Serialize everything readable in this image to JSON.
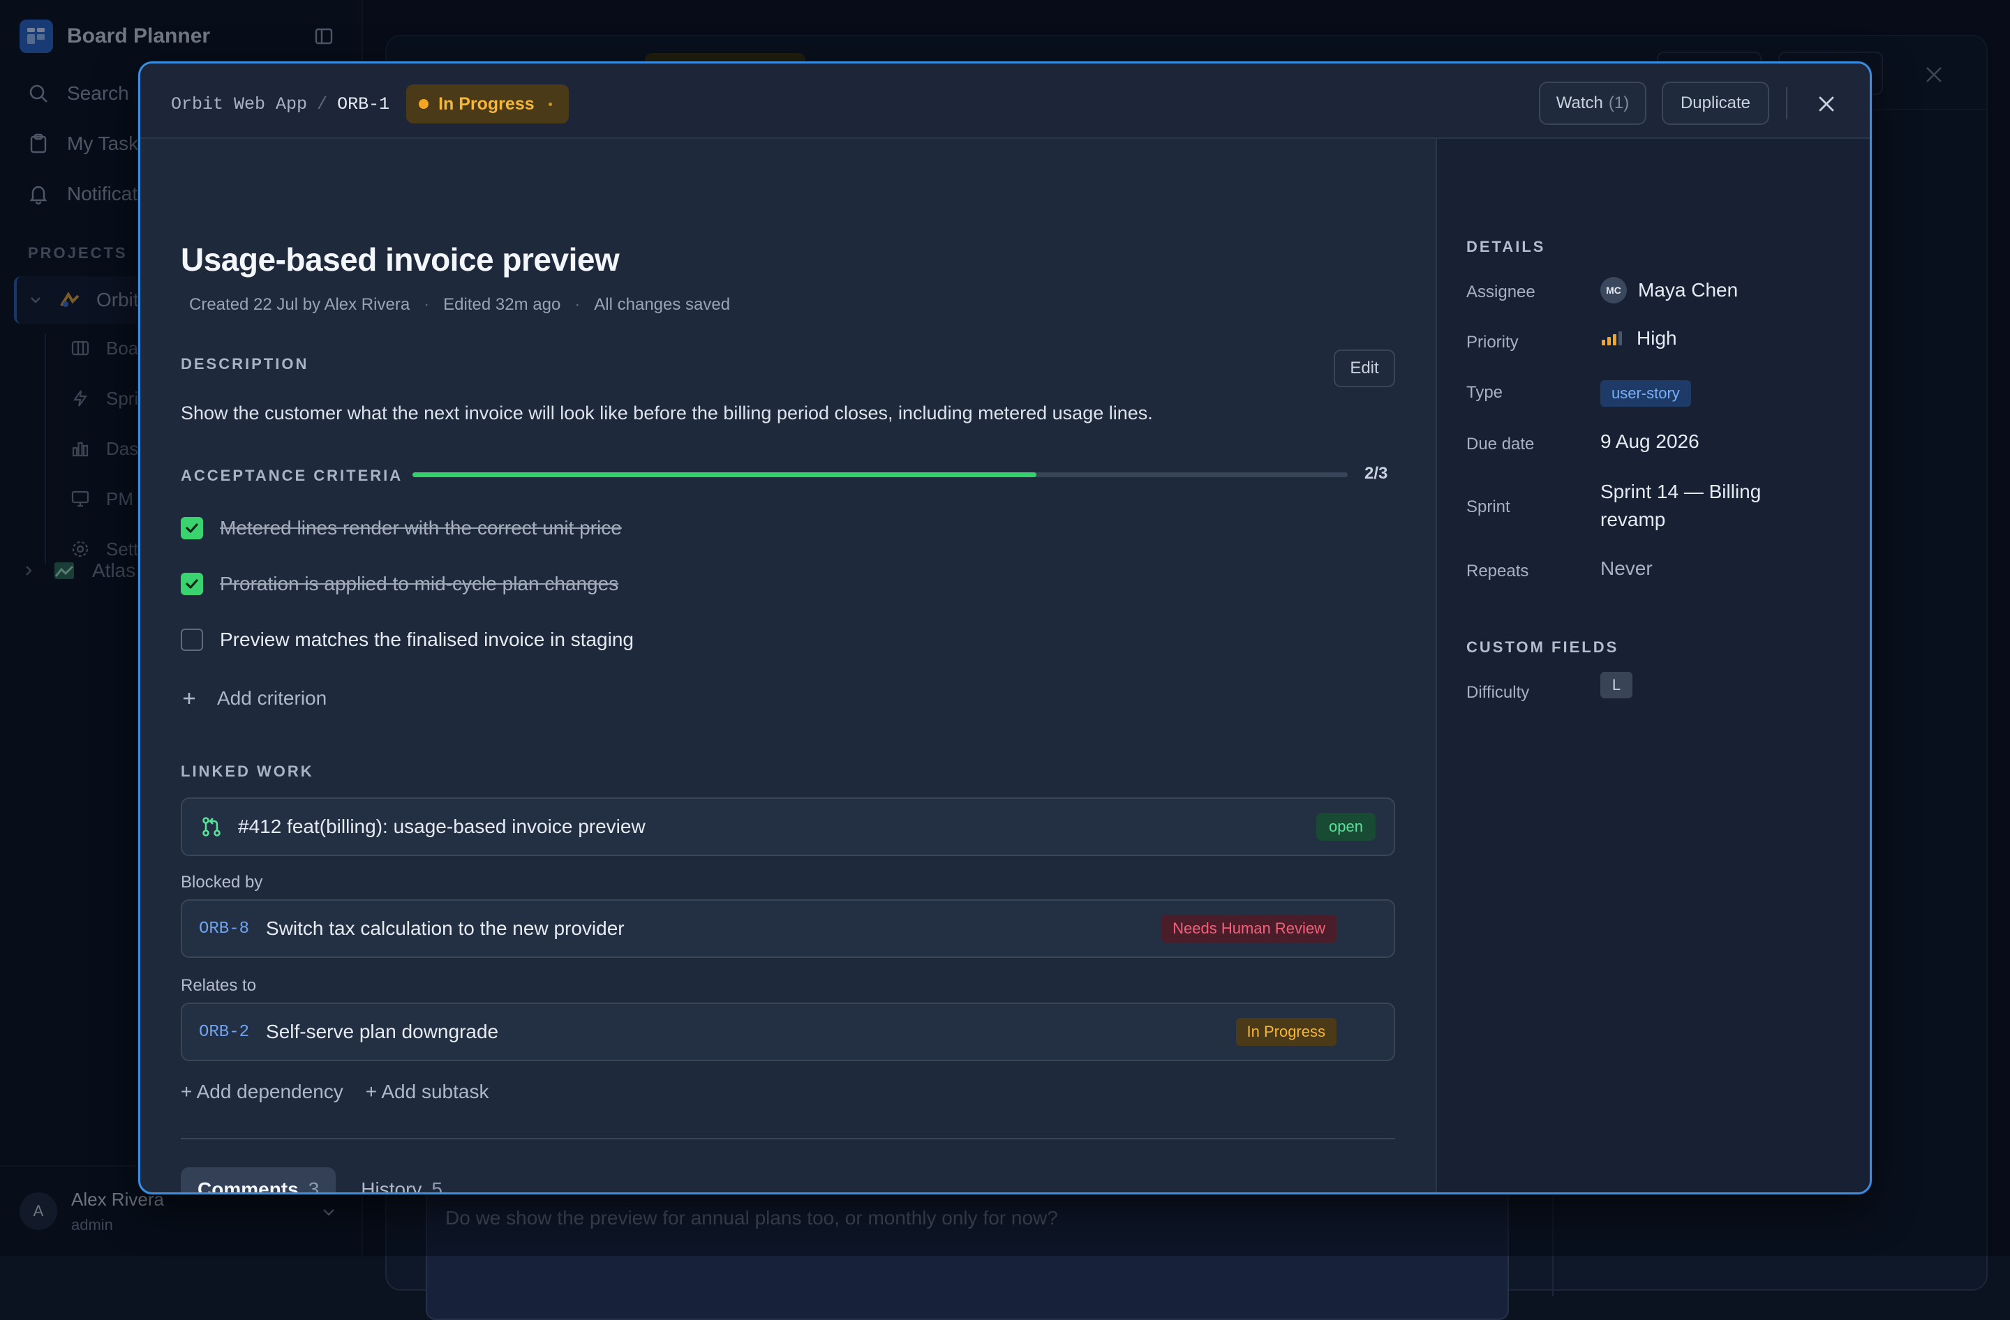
{
  "app": {
    "brand": "Board Planner",
    "nav": [
      {
        "label": "Search",
        "icon": "search-icon"
      },
      {
        "label": "My Tasks",
        "icon": "clipboard-icon"
      },
      {
        "label": "Notifications",
        "icon": "bell-icon"
      }
    ],
    "projects_label": "PROJECTS",
    "project_active": "Orbit Web App",
    "project_sub": [
      {
        "label": "Board",
        "icon": "board-icon"
      },
      {
        "label": "Sprints",
        "icon": "bolt-icon"
      },
      {
        "label": "Dashboard",
        "icon": "chart-icon"
      },
      {
        "label": "PM Agent",
        "icon": "monitor-icon"
      },
      {
        "label": "Settings",
        "icon": "gear-icon"
      }
    ],
    "project_other": "Atlas",
    "user": {
      "initial": "A",
      "name": "Alex Rivera",
      "role": "admin"
    },
    "bg_comment_placeholder": "Do we show the preview for annual plans too, or monthly only for now?"
  },
  "modal": {
    "breadcrumb": {
      "project": "Orbit Web App",
      "separator": "/",
      "id": "ORB-1"
    },
    "status": {
      "label": "In Progress",
      "color": "#f5a524"
    },
    "header_buttons": {
      "watch": "Watch",
      "watch_count": "(1)",
      "duplicate": "Duplicate"
    },
    "title": "Usage-based invoice preview",
    "meta": {
      "created": "Created 22 Jul by Alex Rivera",
      "edited": "Edited 32m ago",
      "saved": "All changes saved",
      "sep": "·"
    },
    "description": {
      "label": "DESCRIPTION",
      "edit": "Edit",
      "text": "Show the customer what the next invoice will look like before the billing period closes, including metered usage lines."
    },
    "criteria": {
      "label": "ACCEPTANCE CRITERIA",
      "progress_text": "2/3",
      "progress_fraction": 0.667,
      "items": [
        {
          "text": "Metered lines render with the correct unit price",
          "done": true
        },
        {
          "text": "Proration is applied to mid-cycle plan changes",
          "done": true
        },
        {
          "text": "Preview matches the finalised invoice in staging",
          "done": false
        }
      ],
      "add": "Add criterion"
    },
    "linked": {
      "label": "LINKED WORK",
      "pr": {
        "title": "#412 feat(billing): usage-based invoice preview",
        "badge": "open"
      },
      "blocked_by_label": "Blocked by",
      "blocked_by": {
        "id": "ORB-8",
        "title": "Switch tax calculation to the new provider",
        "badge": "Needs Human Review"
      },
      "relates_to_label": "Relates to",
      "relates_to": {
        "id": "ORB-2",
        "title": "Self-serve plan downgrade",
        "badge": "In Progress"
      },
      "add_dependency": "+ Add dependency",
      "add_subtask": "+ Add subtask"
    },
    "tabs": [
      {
        "label": "Comments",
        "count": "3",
        "active": true
      },
      {
        "label": "History",
        "count": "5",
        "active": false
      }
    ],
    "details": {
      "label": "DETAILS",
      "assignee_k": "Assignee",
      "assignee_initials": "MC",
      "assignee_v": "Maya Chen",
      "priority_k": "Priority",
      "priority_v": "High",
      "priority_level": 3,
      "priority_max": 4,
      "type_k": "Type",
      "type_v": "user-story",
      "due_k": "Due date",
      "due_v": "9 Aug 2026",
      "sprint_k": "Sprint",
      "sprint_v1": "Sprint 14 — Billing",
      "sprint_v2": "revamp",
      "repeats_k": "Repeats",
      "repeats_v": "Never"
    },
    "custom": {
      "label": "CUSTOM FIELDS",
      "difficulty_k": "Difficulty",
      "difficulty_v": "L"
    }
  },
  "colors": {
    "accent": "#3b8de0",
    "success": "#3bd36f",
    "warning": "#f5a524",
    "danger": "#f2607a"
  }
}
